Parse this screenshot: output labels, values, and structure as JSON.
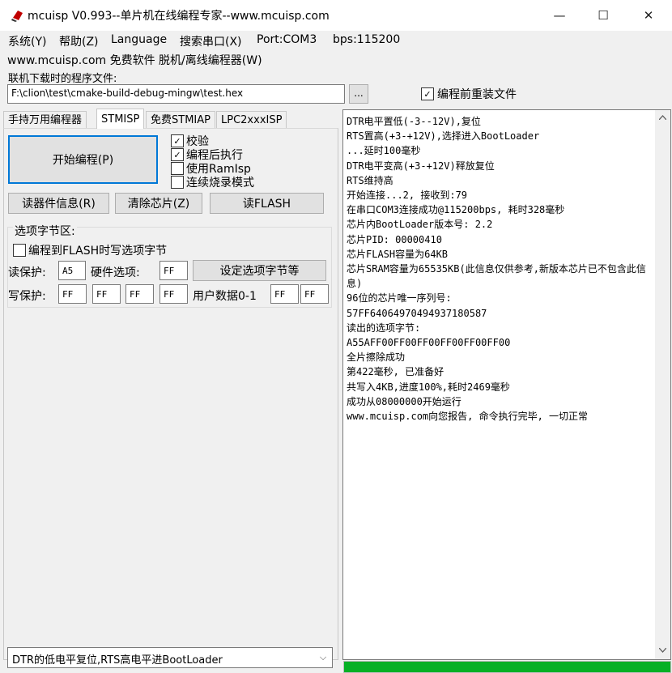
{
  "window": {
    "title": "mcuisp V0.993--单片机在线编程专家--www.mcuisp.com",
    "minimize": "—",
    "maximize": "☐",
    "close": "✕"
  },
  "menu": {
    "items": [
      {
        "label": "系统(Y)"
      },
      {
        "label": "帮助(Z)"
      },
      {
        "label": "Language"
      },
      {
        "label": "搜索串口(X)"
      },
      {
        "label": "Port:COM3"
      },
      {
        "label": "bps:115200"
      }
    ],
    "row2": {
      "label": "www.mcuisp.com 免费软件 脱机/离线编程器(W)"
    }
  },
  "file": {
    "label": "联机下载时的程序文件:",
    "path": "F:\\clion\\test\\cmake-build-debug-mingw\\test.hex",
    "browse": "...",
    "reload_label": "编程前重装文件",
    "reload_checked": true
  },
  "tabs": [
    {
      "label": "手持万用编程器",
      "active": false
    },
    {
      "label": "STMISP",
      "active": true
    },
    {
      "label": "免费STMIAP",
      "active": false
    },
    {
      "label": "LPC2xxxISP",
      "active": false
    }
  ],
  "program": {
    "start_label": "开始编程(P)",
    "options": [
      {
        "label": "校验",
        "checked": true
      },
      {
        "label": "编程后执行",
        "checked": true
      },
      {
        "label": "使用RamIsp",
        "checked": false
      },
      {
        "label": "连续烧录模式",
        "checked": false
      }
    ],
    "read_info": "读器件信息(R)",
    "erase": "清除芯片(Z)",
    "read_flash": "读FLASH"
  },
  "option_bytes": {
    "title": "选项字节区:",
    "write_on_flash_label": "编程到FLASH时写选项字节",
    "write_on_flash_checked": false,
    "read_protect_label": "读保护:",
    "read_protect": "A5",
    "hw_option_label": "硬件选项:",
    "hw_option": "FF",
    "set_button": "设定选项字节等",
    "write_protect_label": "写保护:",
    "write_protect": [
      "FF",
      "FF",
      "FF",
      "FF"
    ],
    "user_data_label": "用户数据0-1",
    "user_data": [
      "FF",
      "FF"
    ]
  },
  "mode": {
    "selected": "DTR的低电平复位,RTS高电平进BootLoader",
    "chevron": "⌵"
  },
  "log": {
    "lines": [
      "DTR电平置低(-3--12V),复位",
      "RTS置高(+3-+12V),选择进入BootLoader",
      "...延时100毫秒",
      "DTR电平变高(+3-+12V)释放复位",
      "RTS维持高",
      "开始连接...2, 接收到:79",
      "在串口COM3连接成功@115200bps, 耗时328毫秒",
      "芯片内BootLoader版本号: 2.2",
      "芯片PID: 00000410",
      "芯片FLASH容量为64KB",
      "芯片SRAM容量为65535KB(此信息仅供参考,新版本芯片已不包含此信息)",
      "96位的芯片唯一序列号:",
      "57FF64064970494937180587",
      "读出的选项字节:",
      "A55AFF00FF00FF00FF00FF00FF00",
      "全片擦除成功",
      "第422毫秒, 已准备好",
      "共写入4KB,进度100%,耗时2469毫秒",
      "成功从08000000开始运行",
      "www.mcuisp.com向您报告, 命令执行完毕, 一切正常"
    ]
  },
  "progress": {
    "value": 1.0,
    "color": "#06b025"
  }
}
